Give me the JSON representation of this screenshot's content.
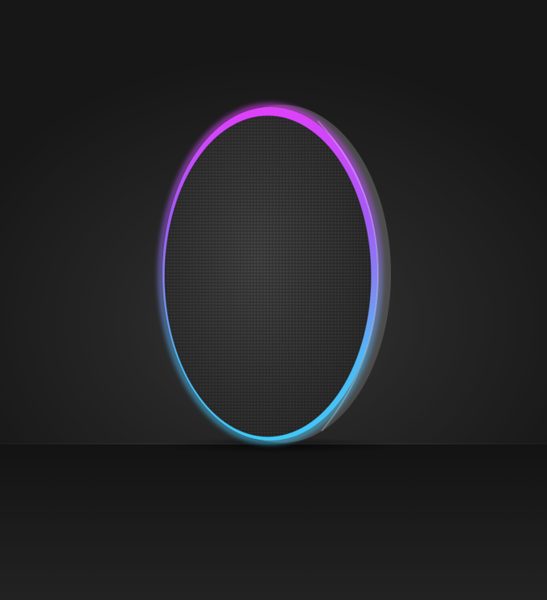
{
  "scene": {
    "subject": "wireless-charging-pad",
    "colors": {
      "background_dark": "#111111",
      "wall_center": "#363636",
      "ring_top": "#e040fb",
      "ring_mid": "#8e6cf0",
      "ring_bottom": "#40c8f8",
      "fabric": "#3a3b3a",
      "rim_gray": "#555555"
    }
  }
}
